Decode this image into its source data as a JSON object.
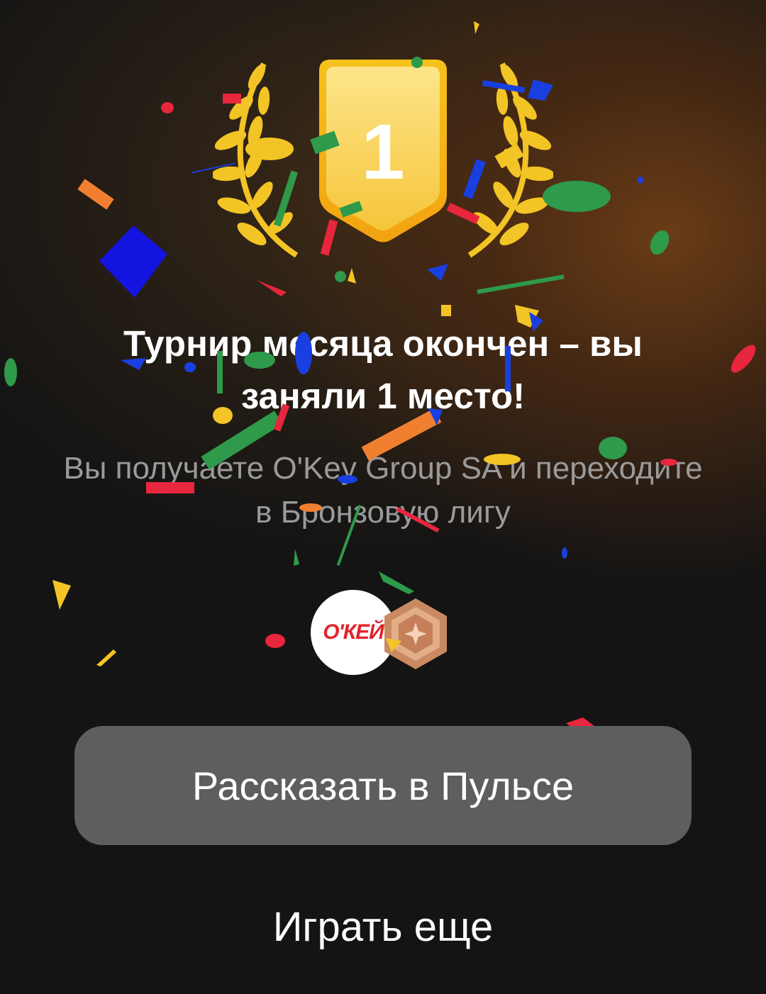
{
  "place_badge": {
    "number": "1"
  },
  "title": "Турнир месяца окончен – вы заняли 1 место!",
  "subtitle": "Вы получаете O'Key Group SA и переходите в Бронзовую лигу",
  "stock": {
    "logo_text": "О'КЕЙ",
    "icon": "okey-logo-icon",
    "brand_color": "#e0242c"
  },
  "league": {
    "icon": "bronze-league-icon",
    "color": "#c98a62"
  },
  "buttons": {
    "share_label": "Рассказать в Пульсе",
    "play_again_label": "Играть еще"
  },
  "colors": {
    "background": "#141414",
    "button_bg": "#5d5f5e",
    "badge_gold": "#f5b415",
    "laurel_gold": "#f3c425"
  }
}
